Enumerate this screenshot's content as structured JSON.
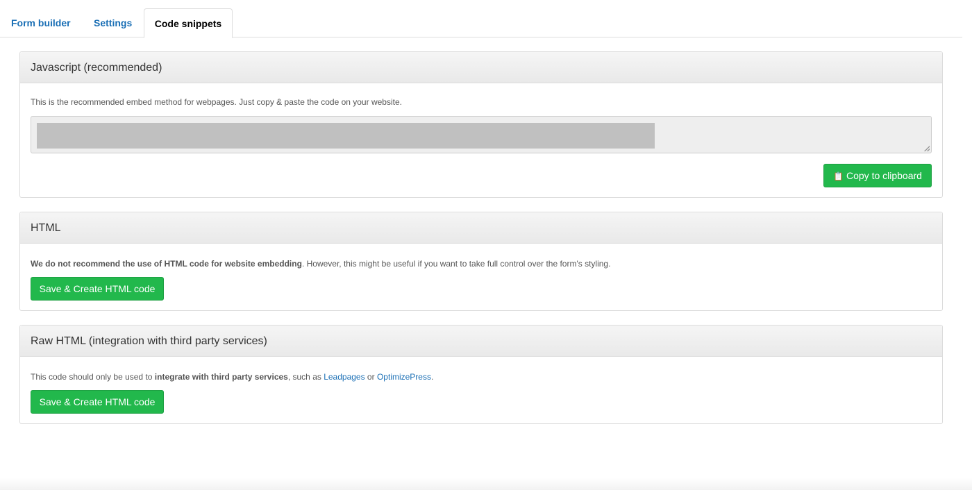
{
  "tabs": [
    {
      "label": "Form builder",
      "active": false
    },
    {
      "label": "Settings",
      "active": false
    },
    {
      "label": "Code snippets",
      "active": true
    }
  ],
  "javascript_panel": {
    "title": "Javascript (recommended)",
    "description": "This is the recommended embed method for webpages. Just copy & paste the code on your website.",
    "copy_button": {
      "icon": "clipboard-icon",
      "label": "Copy to clipboard"
    }
  },
  "html_panel": {
    "title": "HTML",
    "description_bold": "We do not recommend the use of HTML code for website embedding",
    "description_rest": ". However, this might be useful if you want to take full control over the form's styling.",
    "button_label": "Save & Create HTML code"
  },
  "raw_html_panel": {
    "title": "Raw HTML (integration with third party services)",
    "description_start": "This code should only be used to ",
    "description_bold": "integrate with third party services",
    "description_mid": ", such as ",
    "link1": "Leadpages",
    "description_or": " or ",
    "link2": "OptimizePress",
    "description_end": ".",
    "button_label": "Save & Create HTML code"
  },
  "colors": {
    "accent_green": "#22b84c",
    "link_blue": "#1a6fb5"
  }
}
